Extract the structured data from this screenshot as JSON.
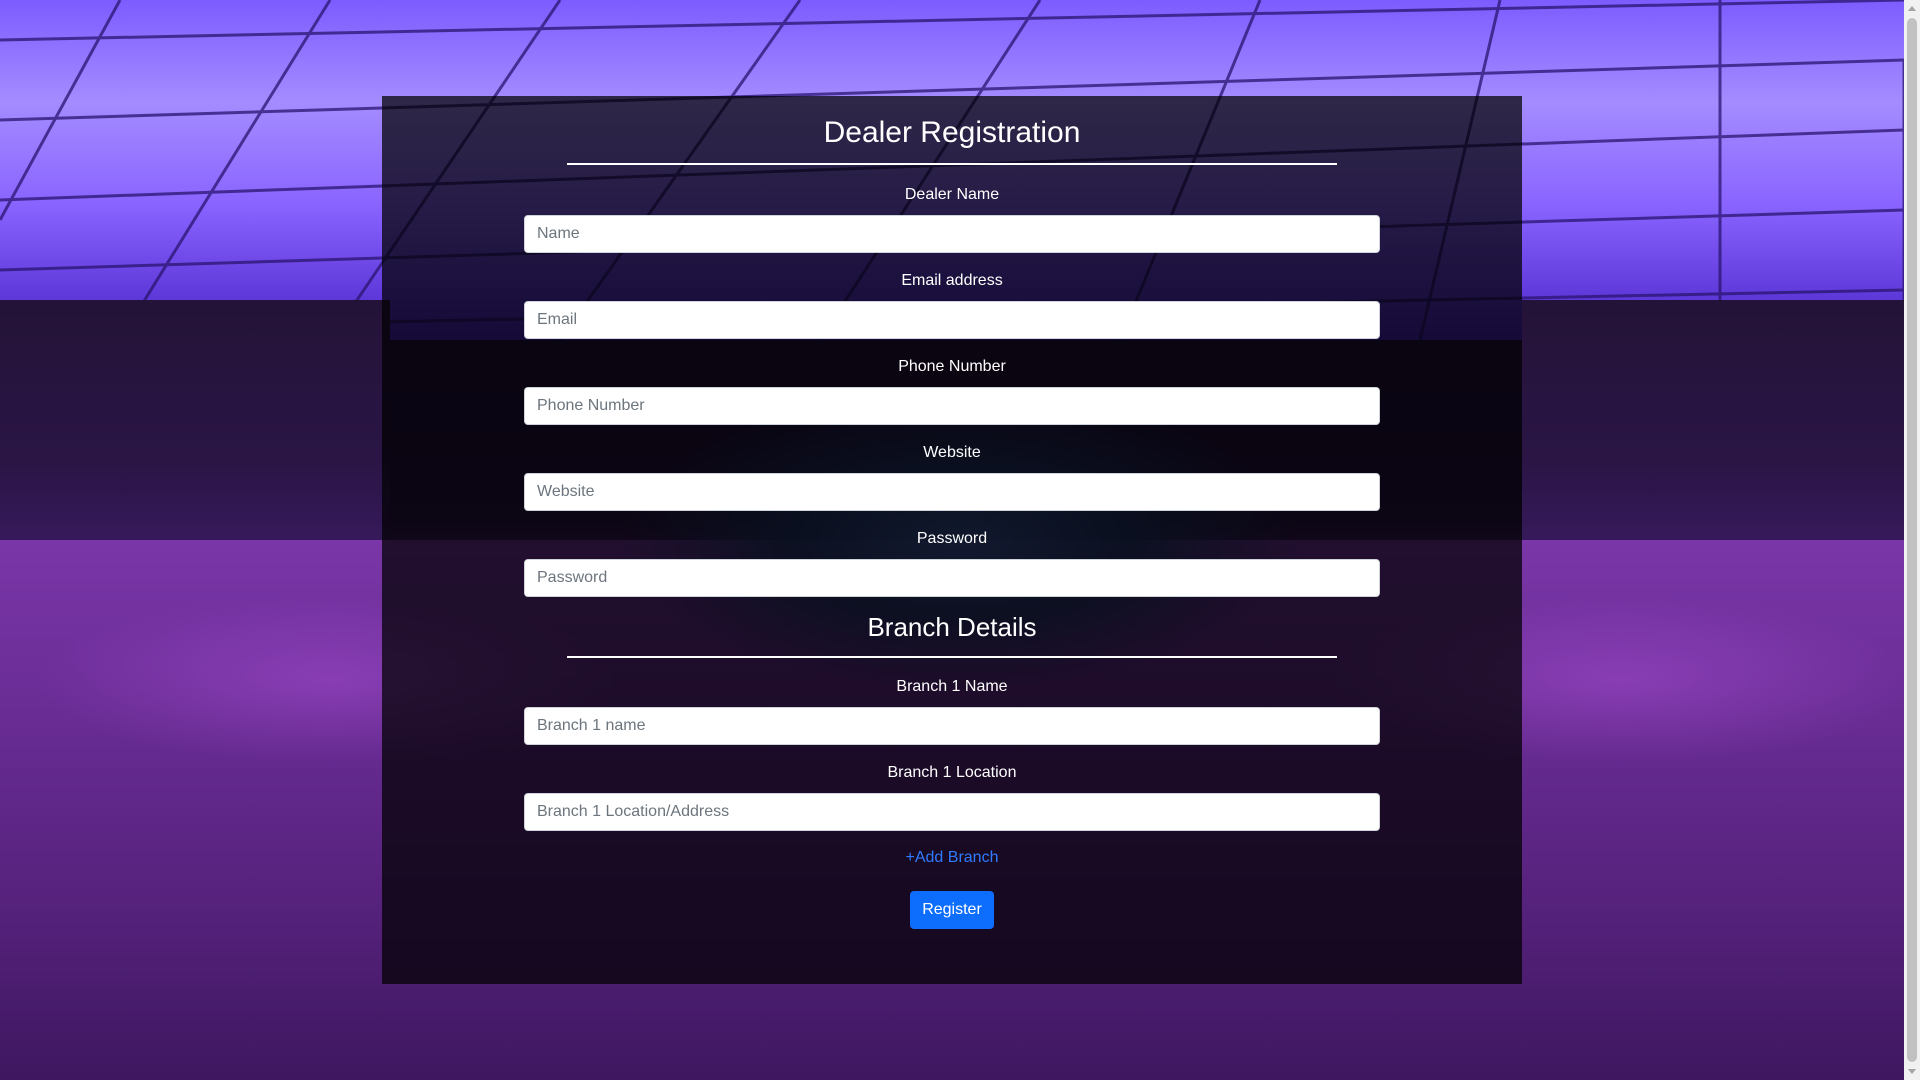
{
  "form": {
    "title": "Dealer Registration",
    "fields": [
      {
        "label": "Dealer Name",
        "placeholder": "Name",
        "value": ""
      },
      {
        "label": "Email address",
        "placeholder": "Email",
        "value": ""
      },
      {
        "label": "Phone Number",
        "placeholder": "Phone Number",
        "value": ""
      },
      {
        "label": "Website",
        "placeholder": "Website",
        "value": ""
      },
      {
        "label": "Password",
        "placeholder": "Password",
        "value": ""
      }
    ]
  },
  "branch": {
    "title": "Branch Details",
    "fields": [
      {
        "label": "Branch 1 Name",
        "placeholder": "Branch 1 name",
        "value": ""
      },
      {
        "label": "Branch 1 Location",
        "placeholder": "Branch 1 Location/Address",
        "value": ""
      }
    ],
    "add_label": "+Add Branch"
  },
  "actions": {
    "register_label": "Register",
    "register_color": "#0d6efd",
    "link_color": "#2f7bff"
  },
  "background": {
    "accent": "#6a2c90"
  }
}
